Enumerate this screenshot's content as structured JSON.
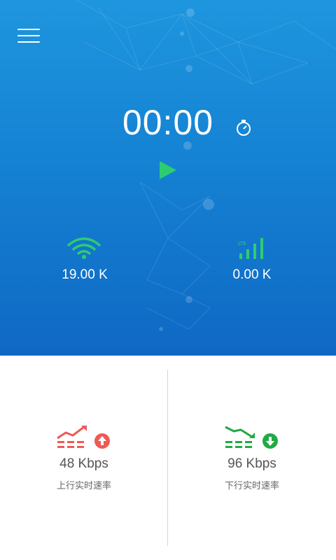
{
  "header": {
    "menu_icon": "hamburger-menu-icon"
  },
  "timer": {
    "display": "00:00",
    "stopwatch_icon": "stopwatch-icon",
    "play_icon": "play-icon"
  },
  "stats": {
    "wifi": {
      "icon": "wifi-icon",
      "value": "19.00 K",
      "color": "#2ecc71"
    },
    "mobile": {
      "icon": "lte-signal-icon",
      "badge": "LTE",
      "value": "0.00 K",
      "color": "#2ecc71"
    }
  },
  "speeds": {
    "upload": {
      "value": "48 Kbps",
      "label": "上行实时速率",
      "icon": "upload-trend-icon",
      "color": "#ee5a55"
    },
    "download": {
      "value": "96 Kbps",
      "label": "下行实时速率",
      "icon": "download-trend-icon",
      "color": "#22aa44"
    }
  },
  "colors": {
    "hero_top": "#1e96de",
    "hero_bottom": "#0f68c4",
    "accent_green": "#2ecc71"
  }
}
